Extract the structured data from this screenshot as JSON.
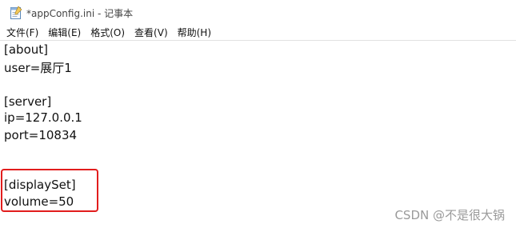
{
  "window": {
    "title": "*appConfig.ini - 记事本",
    "icon": "notepad-icon"
  },
  "menu": {
    "items": [
      {
        "label": "文件(F)"
      },
      {
        "label": "编辑(E)"
      },
      {
        "label": "格式(O)"
      },
      {
        "label": "查看(V)"
      },
      {
        "label": "帮助(H)"
      }
    ]
  },
  "editor": {
    "lines": [
      "[about]",
      "user=展厅1",
      "",
      "[server]",
      "ip=127.0.0.1",
      "port=10834",
      "",
      "",
      "[displaySet]",
      "volume=50"
    ]
  },
  "annotation": {
    "highlight_color": "#e21d1d"
  },
  "watermark": {
    "text": "CSDN @不是很大锅"
  }
}
